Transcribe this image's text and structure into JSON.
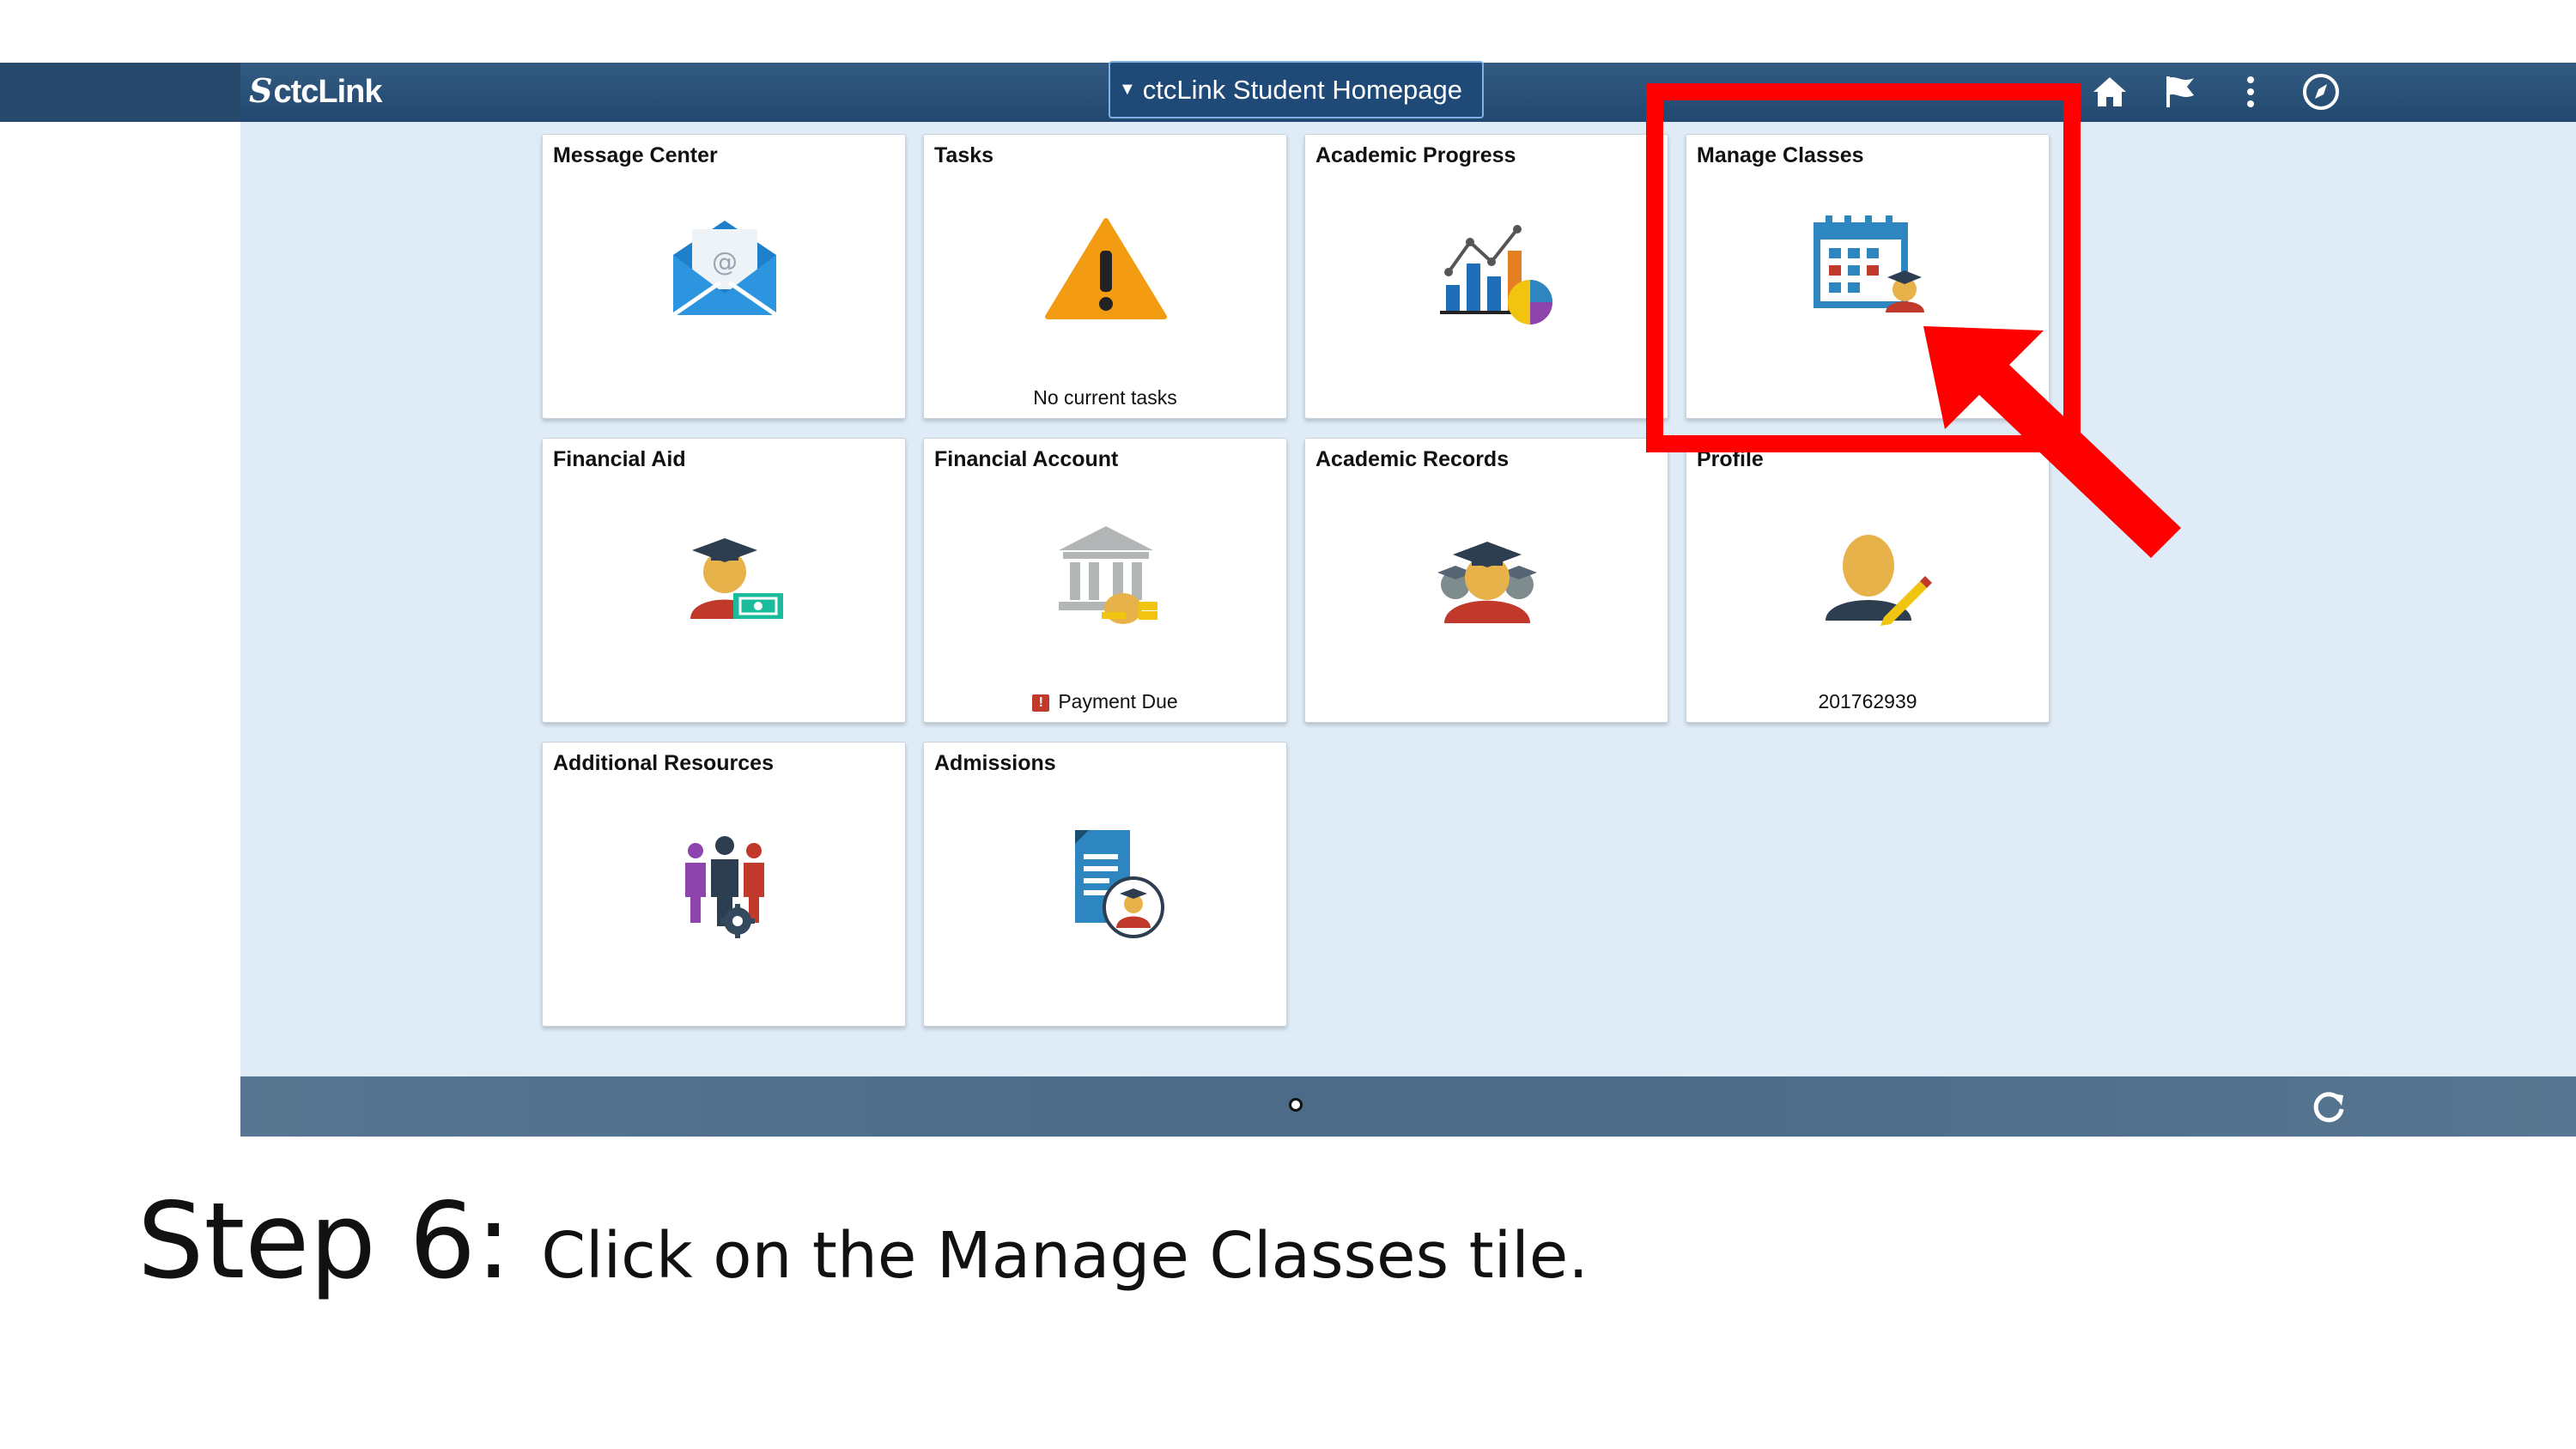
{
  "header": {
    "logo": "ctcLink",
    "homepage_selector": "ctcLink Student Homepage",
    "icons": [
      "home-icon",
      "flag-icon",
      "more-vertical-icon",
      "navbar-compass-icon"
    ]
  },
  "tiles": [
    {
      "title": "Message Center",
      "subtitle": "",
      "icon": "envelope-icon"
    },
    {
      "title": "Tasks",
      "subtitle": "No current tasks",
      "icon": "warning-icon"
    },
    {
      "title": "Academic Progress",
      "subtitle": "",
      "icon": "chart-icon"
    },
    {
      "title": "Manage Classes",
      "subtitle": "",
      "icon": "calendar-student-icon"
    },
    {
      "title": "Financial Aid",
      "subtitle": "",
      "icon": "student-money-icon"
    },
    {
      "title": "Financial Account",
      "subtitle": "Payment Due",
      "icon": "bank-icon"
    },
    {
      "title": "Academic Records",
      "subtitle": "",
      "icon": "graduates-icon"
    },
    {
      "title": "Profile",
      "subtitle": "201762939",
      "icon": "profile-edit-icon"
    },
    {
      "title": "Additional Resources",
      "subtitle": "",
      "icon": "people-gear-icon"
    },
    {
      "title": "Admissions",
      "subtitle": "",
      "icon": "document-student-icon"
    }
  ],
  "footer": {
    "icons": [
      "page-indicator-dot",
      "refresh-icon"
    ]
  },
  "instruction": {
    "step": "Step 6:",
    "text_before": "Click on the",
    "highlight": "Manage Classes",
    "text_after": "tile."
  },
  "colors": {
    "header": "#27496b",
    "page_bg": "#dfecf7",
    "annotation": "#ff0000"
  }
}
